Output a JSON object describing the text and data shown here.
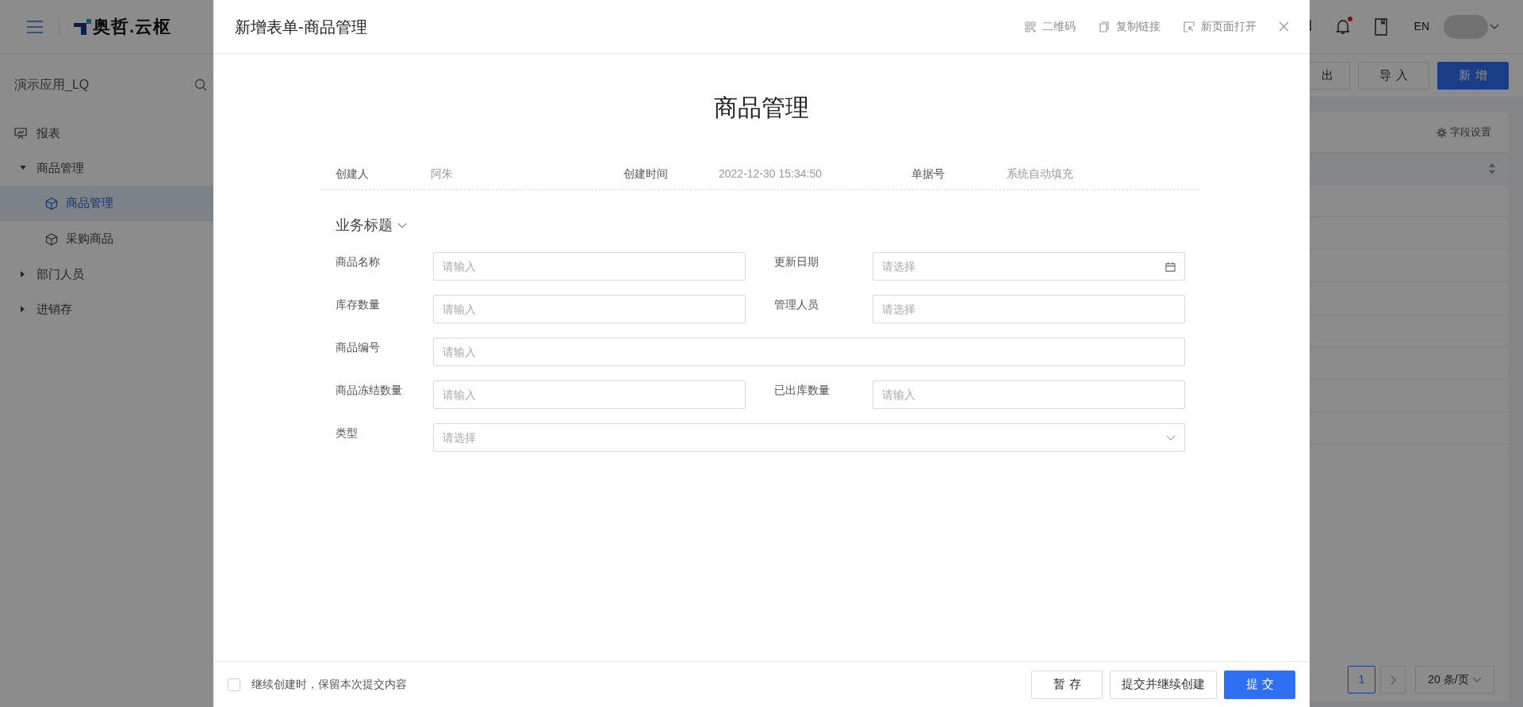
{
  "topbar": {
    "logo_text": "奥哲.云枢",
    "notification_dot": true,
    "language": "EN"
  },
  "sidebar": {
    "app_name": "演示应用_LQ",
    "items": [
      {
        "label": "报表",
        "kind": "report",
        "selected": false
      },
      {
        "label": "商品管理",
        "kind": "group",
        "expanded": true,
        "selected": false,
        "children": [
          {
            "label": "商品管理",
            "kind": "form",
            "selected": true
          },
          {
            "label": "采购商品",
            "kind": "form",
            "selected": false
          }
        ]
      },
      {
        "label": "部门人员",
        "kind": "group",
        "expanded": false,
        "selected": false
      },
      {
        "label": "进销存",
        "kind": "group",
        "expanded": false,
        "selected": false
      }
    ]
  },
  "toolbar": {
    "buttons": [
      {
        "label": "出",
        "kind": "default"
      },
      {
        "label": "导入",
        "kind": "default"
      },
      {
        "label": "新增",
        "kind": "primary"
      }
    ]
  },
  "list_panel": {
    "field_settings": "字段设置",
    "pagination": {
      "pages": [
        {
          "label": "1",
          "selected": true
        }
      ],
      "page_size": "20 条/页"
    }
  },
  "modal": {
    "title": "新增表单-商品管理",
    "actions": [
      {
        "label": "二维码",
        "kind": "qrcode"
      },
      {
        "label": "复制链接",
        "kind": "copy"
      },
      {
        "label": "新页面打开",
        "kind": "open"
      }
    ],
    "form_title": "商品管理",
    "meta": [
      {
        "label": "创建人",
        "value": "阿朱"
      },
      {
        "label": "创建时间",
        "value": "2022-12-30 15:34:50"
      },
      {
        "label": "单据号",
        "value": "系统自动填充"
      }
    ],
    "section": {
      "title": "业务标题",
      "expanded": true
    },
    "field_rows": [
      [
        {
          "label": "商品名称",
          "placeholder": "请输入",
          "kind": "text"
        },
        {
          "label": "更新日期",
          "placeholder": "请选择",
          "kind": "date"
        }
      ],
      [
        {
          "label": "库存数量",
          "placeholder": "请输入",
          "kind": "text"
        },
        {
          "label": "管理人员",
          "placeholder": "请选择",
          "kind": "picker"
        }
      ],
      [
        {
          "label": "商品编号",
          "placeholder": "请输入",
          "kind": "text"
        }
      ],
      [
        {
          "label": "商品冻结数量",
          "placeholder": "请输入",
          "kind": "text"
        },
        {
          "label": "已出库数量",
          "placeholder": "请输入",
          "kind": "text"
        }
      ],
      [
        {
          "label": "类型",
          "placeholder": "请选择",
          "kind": "select"
        }
      ]
    ],
    "footer": {
      "keep_option": {
        "label": "继续创建时，保留本次提交内容",
        "checked": false
      },
      "buttons": [
        {
          "label": "暂存",
          "kind": "default"
        },
        {
          "label": "提交并继续创建",
          "kind": "default"
        },
        {
          "label": "提交",
          "kind": "primary"
        }
      ]
    }
  }
}
